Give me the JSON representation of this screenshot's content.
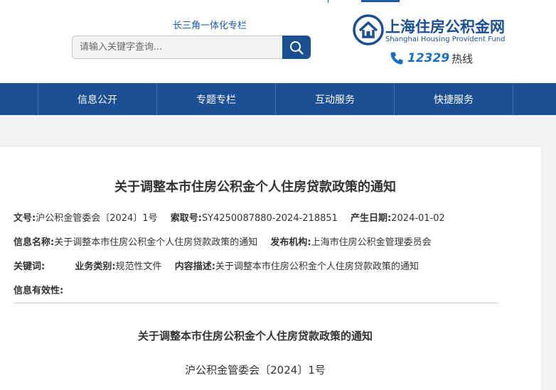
{
  "header": {
    "yrd_link": "长三角一体化专栏",
    "search_placeholder": "请输入关键字查询...",
    "logo_cn": "上海住房公积金网",
    "logo_en": "Shanghai Housing Provident Fund",
    "hotline_number": "12329",
    "hotline_label": "热线"
  },
  "nav": {
    "items": [
      {
        "label": "信息公开"
      },
      {
        "label": "专题专栏"
      },
      {
        "label": "互动服务"
      },
      {
        "label": "快捷服务"
      }
    ]
  },
  "article": {
    "title": "关于调整本市住房公积金个人住房贷款政策的通知",
    "meta": {
      "doc_no_label": "文号:",
      "doc_no": "沪公积金管委会〔2024〕1号",
      "index_label": "索取号:",
      "index": "SY4250087880-2024-218851",
      "date_label": "产生日期:",
      "date": "2024-01-02",
      "info_name_label": "信息名称:",
      "info_name": "关于调整本市住房公积金个人住房贷款政策的通知",
      "publisher_label": "发布机构:",
      "publisher": "上海市住房公积金管理委员会",
      "keywords_label": "关键词:",
      "keywords": "",
      "category_label": "业务类别:",
      "category": "规范性文件",
      "desc_label": "内容描述:",
      "desc": "关于调整本市住房公积金个人住房贷款政策的通知",
      "validity_label": "信息有效性:",
      "validity": ""
    },
    "body_title": "关于调整本市住房公积金个人住房贷款政策的通知",
    "body_doc_no": "沪公积金管委会〔2024〕1号"
  },
  "colors": {
    "brand_blue": "#1b4f93",
    "link_blue": "#1b5aa6"
  }
}
